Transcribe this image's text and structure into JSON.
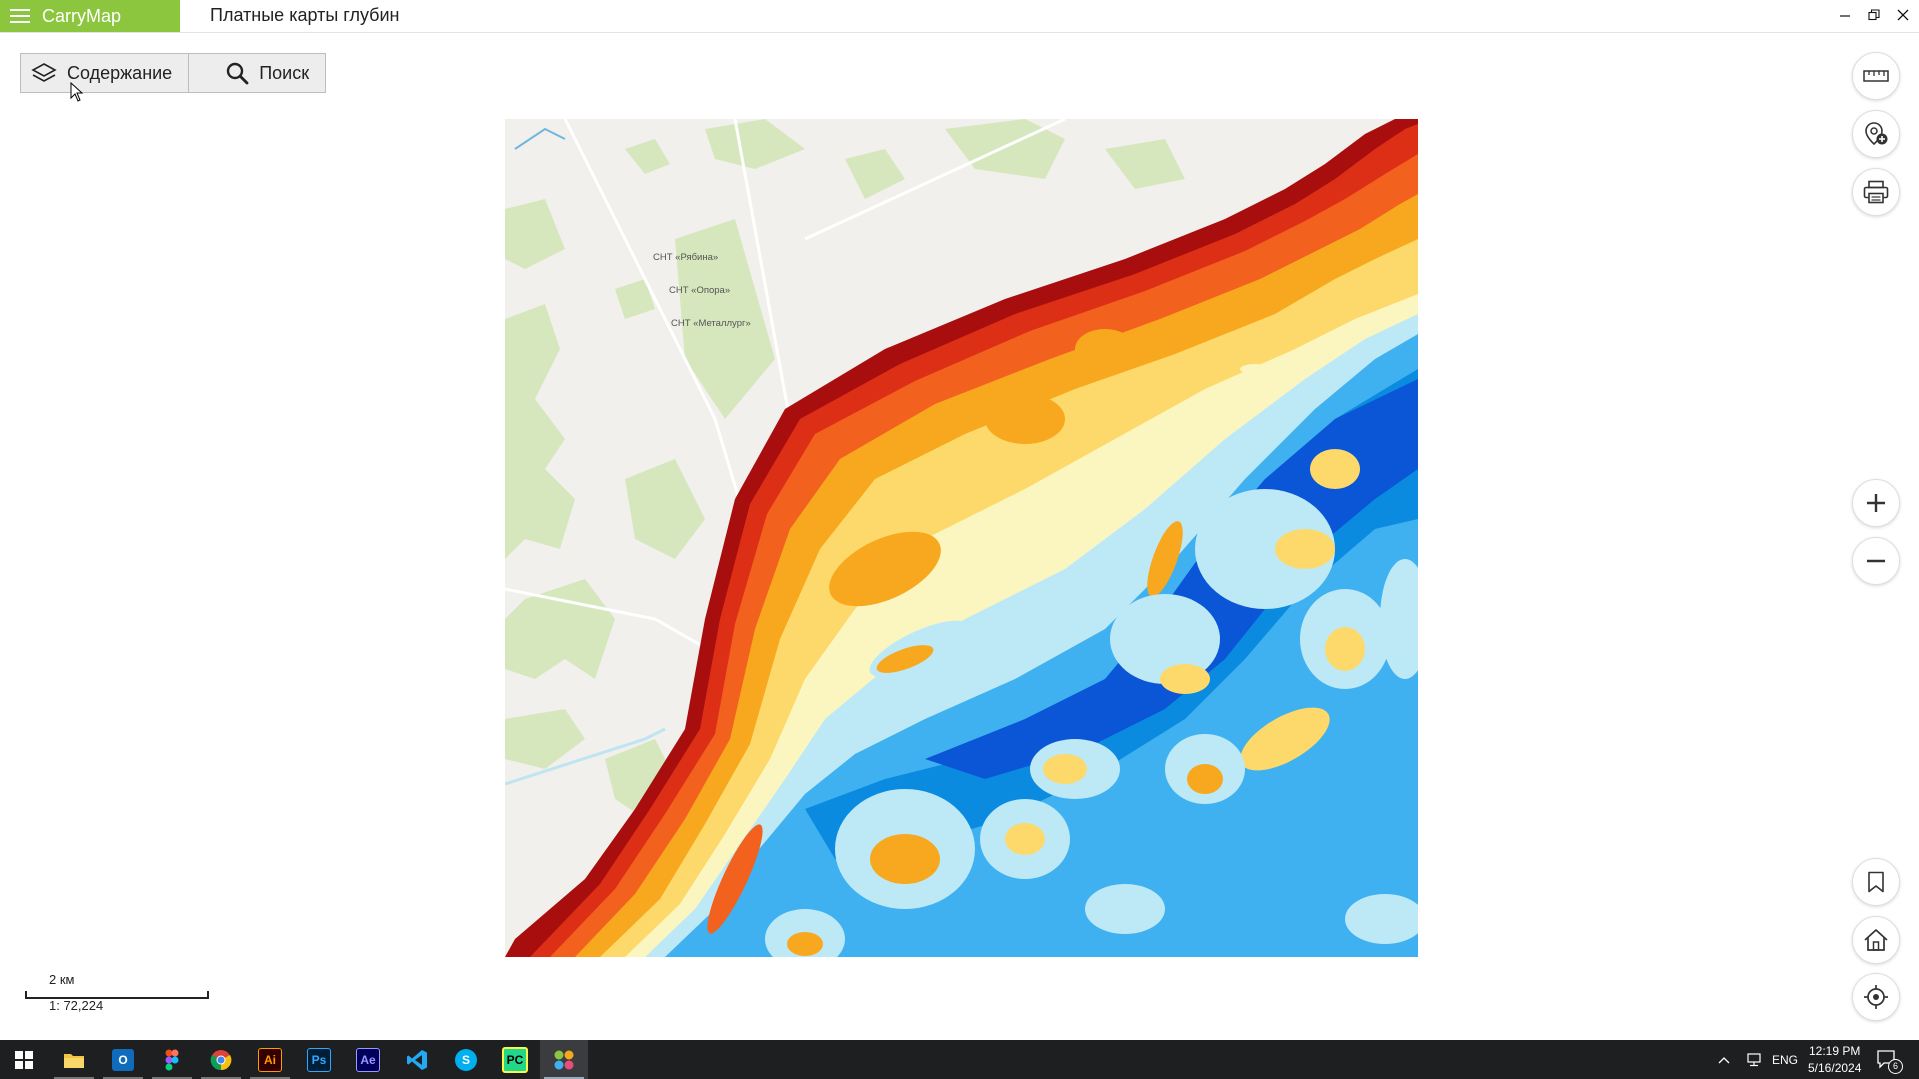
{
  "titlebar": {
    "app_name": "CarryMap",
    "document_title": "Платные карты глубин"
  },
  "toolbar": {
    "contents_label": "Содержание",
    "search_label": "Поиск"
  },
  "map": {
    "labels": {
      "snt_1": "СНТ «Рябина»",
      "snt_2": "СНТ «Опора»",
      "snt_3": "СНТ «Металлург»"
    },
    "depth_palette": [
      "#a80e0e",
      "#dd2f16",
      "#f3611e",
      "#f7a81f",
      "#fcd96a",
      "#fbf6c0",
      "#bde9f7",
      "#3fb1f0",
      "#0a8be0",
      "#0a56d6"
    ]
  },
  "scale": {
    "distance": "2 км",
    "ratio": "1: 72,224"
  },
  "taskbar": {
    "apps": [
      "start-icon",
      "file-explorer-icon",
      "outlook-icon",
      "figma-icon",
      "chrome-icon",
      "illustrator-icon",
      "photoshop-icon",
      "after-effects-icon",
      "vscode-icon",
      "skype-icon",
      "pycharm-icon",
      "carrymap-icon"
    ],
    "language": "ENG",
    "time": "12:19 PM",
    "date": "5/16/2024",
    "notifications": "6"
  }
}
